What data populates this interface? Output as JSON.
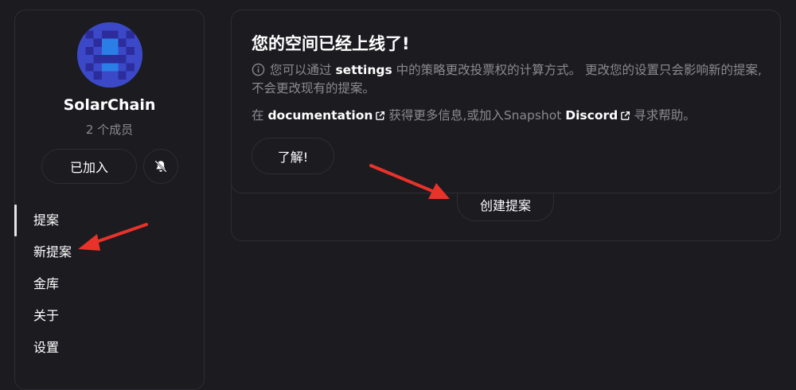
{
  "sidebar": {
    "space_name": "SolarChain",
    "members": "2 个成员",
    "join_label": "已加入",
    "nav_items": [
      {
        "label": "提案",
        "active": true
      },
      {
        "label": "新提案"
      },
      {
        "label": "金库"
      },
      {
        "label": "关于"
      },
      {
        "label": "设置"
      }
    ]
  },
  "notice": {
    "title": "您的空间已经上线了!",
    "text_part1": "您可以通过",
    "settings_link": "settings",
    "text_part2": "中的策略更改投票权的计算方式。 更改您的设置只会影响新的提案,不会更改现有的提案。",
    "help_prefix": "在",
    "documentation_link": "documentation",
    "help_middle": "获得更多信息,或加入Snapshot",
    "discord_link": "Discord",
    "help_suffix": "寻求帮助。",
    "ok_label": "了解!"
  },
  "main": {
    "create_label": "创建提案"
  },
  "colors": {
    "background": "#1c1b20",
    "border": "#2e2d33",
    "muted_text": "#8b8a90",
    "annotation_arrow": "#e8322a",
    "avatar_dark": "#2d2c9c",
    "avatar_mid": "#3b49c8",
    "avatar_light": "#2a7ee6"
  },
  "icons": [
    "bell-off-icon",
    "info-icon",
    "external-link-icon",
    "avatar-identicon"
  ]
}
